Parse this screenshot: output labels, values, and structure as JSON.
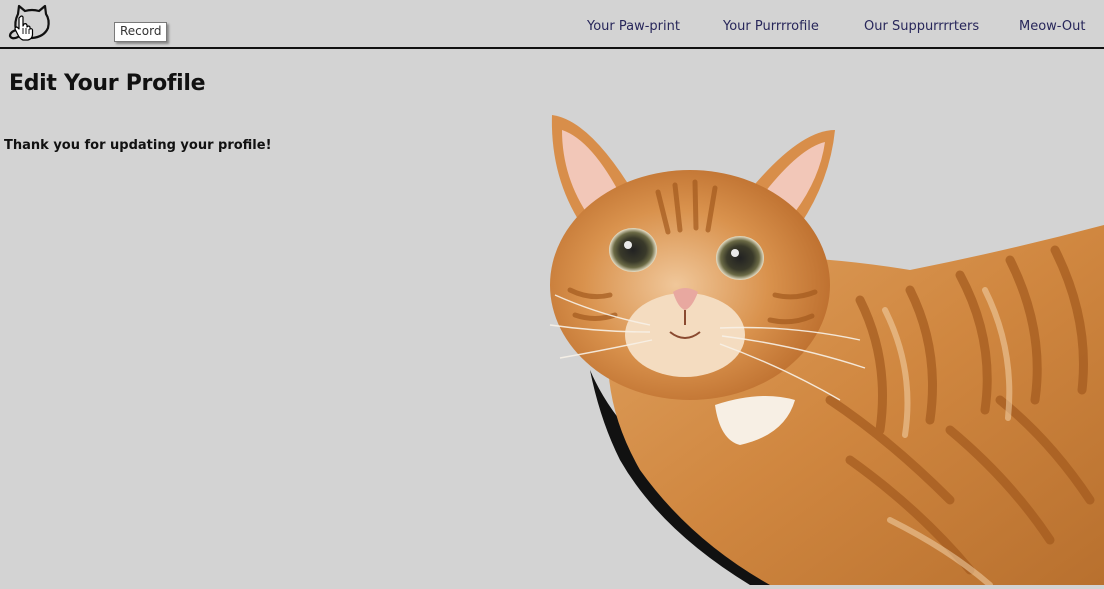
{
  "navbar": {
    "logo_icon": "cat-head-icon",
    "tooltip": "Record",
    "links": [
      {
        "label": "Your Paw-print"
      },
      {
        "label": "Your Purrrrofile"
      },
      {
        "label": "Our Suppurrrrters"
      },
      {
        "label": "Meow-Out"
      }
    ],
    "link_color": "#27265a"
  },
  "main": {
    "title": "Edit Your Profile",
    "message": "Thank you for updating your profile!"
  },
  "background_color": "#d3d3d3",
  "cat_image": {
    "icon": "orange-tabby-cat-image"
  }
}
